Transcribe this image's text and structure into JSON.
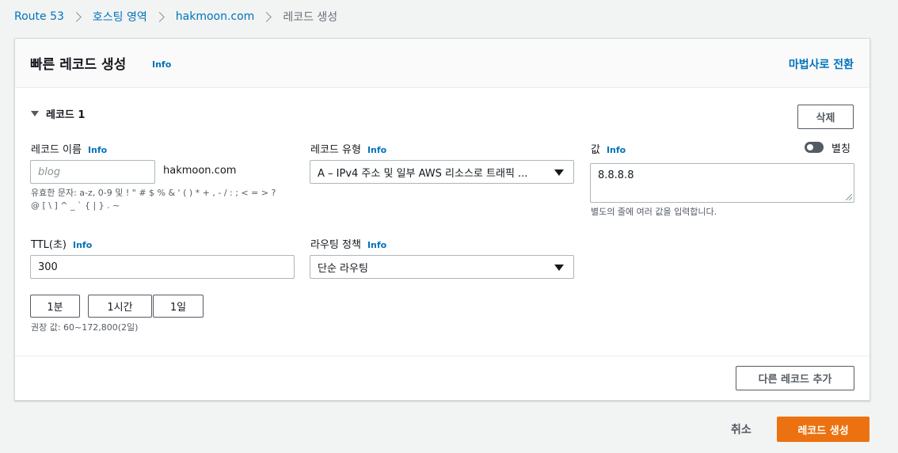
{
  "breadcrumb": [
    "Route 53",
    "호스팅 영역",
    "hakmoon.com",
    "레코드 생성"
  ],
  "header": {
    "title": "빠른 레코드 생성",
    "info": "Info",
    "wizard_link": "마법사로 전환"
  },
  "record": {
    "section_label": "레코드 1",
    "delete_label": "삭제",
    "name": {
      "label": "레코드 이름",
      "info": "Info",
      "placeholder": "blog",
      "value": "",
      "suffix": "hakmoon.com",
      "hint": "유효한 문자: a-z, 0-9 및 ! \" # $ % & ' ( ) * + , - / : ; < = > ? @ [ \\ ] ^ _ ` { | } . ~"
    },
    "type": {
      "label": "레코드 유형",
      "info": "Info",
      "value": "A – IPv4 주소 및 일부 AWS 리소스로 트래픽 ..."
    },
    "value": {
      "label": "값",
      "info": "Info",
      "alias_label": "별칭",
      "alias_on": false,
      "value": "8.8.8.8",
      "hint": "별도의 줄에 여러 값을 입력합니다."
    },
    "ttl": {
      "label": "TTL(초)",
      "info": "Info",
      "value": "300",
      "presets": [
        "1분",
        "1시간",
        "1일"
      ],
      "hint": "권장 값: 60~172,800(2일)"
    },
    "routing": {
      "label": "라우팅 정책",
      "info": "Info",
      "value": "단순 라우팅"
    }
  },
  "add_record_label": "다른 레코드 추가",
  "footer": {
    "cancel_label": "취소",
    "create_label": "레코드 생성"
  },
  "colors": {
    "link": "#0073bb",
    "primary": "#ec7211",
    "background": "#f2f3f3"
  }
}
